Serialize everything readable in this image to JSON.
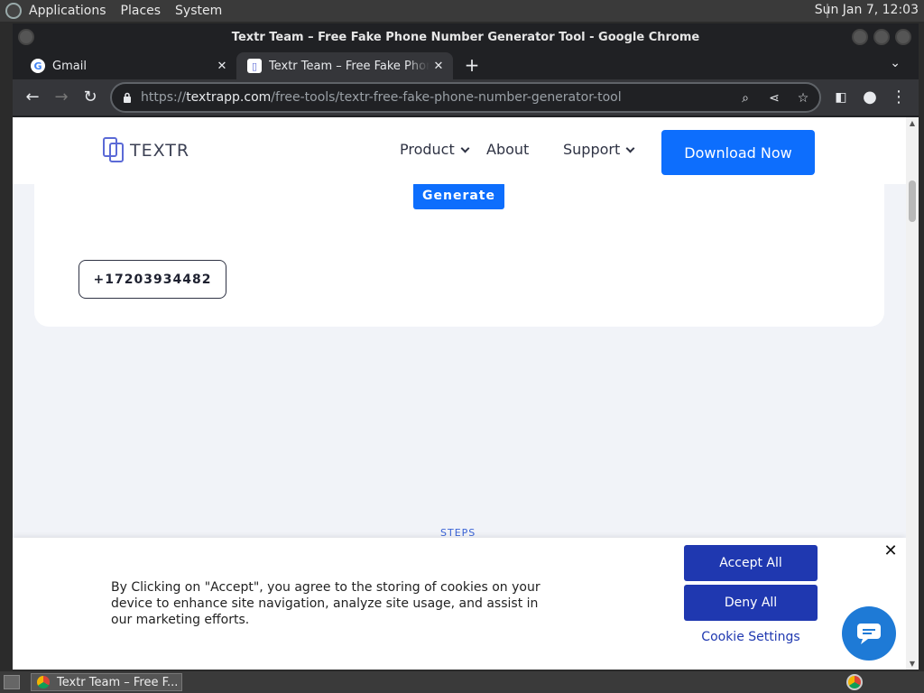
{
  "os": {
    "menus": [
      "Applications",
      "Places",
      "System"
    ],
    "clock": "Sun Jan  7, 12:03"
  },
  "window": {
    "title": "Textr Team – Free Fake Phone Number Generator Tool - Google Chrome"
  },
  "tabs": [
    {
      "label": "Gmail",
      "icon": "gmail-icon"
    },
    {
      "label": "Textr Team – Free Fake Phone Number Generator Tool",
      "icon": "textr-favicon-icon"
    }
  ],
  "address_bar": {
    "url_prefix": "https://",
    "url_host": "textrapp.com",
    "url_path": "/free-tools/textr-free-fake-phone-number-generator-tool"
  },
  "site": {
    "brand": "TEXTR",
    "nav": {
      "product": "Product",
      "about": "About",
      "support": "Support"
    },
    "download_label": "Download Now",
    "generate_label": "Generate",
    "phone_number": "+17203934482",
    "steps_label": "STEPS"
  },
  "cookie": {
    "message": "By Clicking on \"Accept\", you agree to the storing of cookies on your device to enhance site navigation, analyze site usage, and assist in our marketing efforts.",
    "accept_label": "Accept All",
    "deny_label": "Deny All",
    "settings_label": "Cookie Settings"
  },
  "taskbar": {
    "task_label": "Textr Team – Free F..."
  },
  "colors": {
    "brand_blue": "#0d6efd",
    "cookie_blue": "#1f38b0",
    "chat_blue": "#1e7ad6"
  }
}
